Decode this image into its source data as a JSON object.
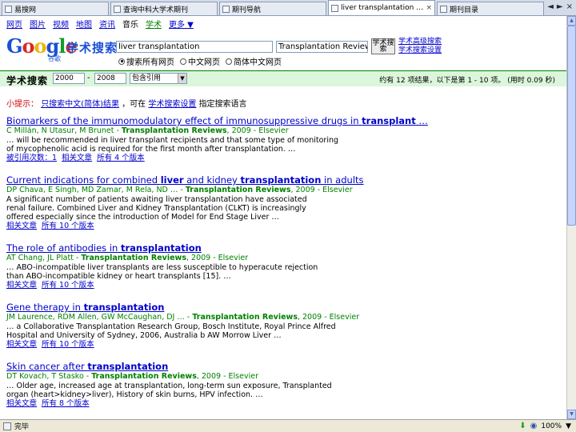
{
  "browser": {
    "tabs": [
      {
        "label": "易搜网",
        "active": false
      },
      {
        "label": "查询中科大学术期刊",
        "active": false
      },
      {
        "label": "期刊导航",
        "active": false
      },
      {
        "label": "liver transplantation - ...",
        "active": true
      },
      {
        "label": "期刊目录",
        "active": false
      }
    ],
    "close_glyph": "×",
    "nav_left": "◄",
    "nav_right": "►",
    "nav_close": "×"
  },
  "gnav": {
    "items": [
      "网页",
      "图片",
      "视频",
      "地图",
      "资讯",
      "音乐",
      "学术",
      "更多 ▼"
    ]
  },
  "logo": {
    "letters": [
      "G",
      "o",
      "o",
      "g",
      "l",
      "e"
    ],
    "subtext": "谷歌",
    "product": "学术搜索"
  },
  "search": {
    "query": "liver transplantation",
    "query2": "Transplantation Reviews",
    "button_label": "学术搜索",
    "advanced_link": "学术高级搜索",
    "settings_link": "学术搜索设置",
    "radios": [
      {
        "label": "搜索所有网页",
        "checked": true
      },
      {
        "label": "中文网页",
        "checked": false
      },
      {
        "label": "简体中文网页",
        "checked": false
      }
    ]
  },
  "results_bar": {
    "title": "学术搜索",
    "year_from": "2000",
    "dash": "-",
    "year_to": "2008",
    "filter_select": "包含引用",
    "arrow": "▼",
    "stats": "约有 12 项结果，以下是第 1 - 10 项。 (用时 0.09 秒)"
  },
  "suggestion": {
    "prefix": "小提示：",
    "link1": "只搜索中文(简体)结果",
    "middle": "，可在",
    "link2": "学术搜索设置",
    "suffix": "指定搜索语言"
  },
  "results": [
    {
      "title_parts": [
        {
          "text": "Biomarkers of the immunomodulatory effect of immunosuppressive drugs in ",
          "bold": false
        },
        {
          "text": "transplant",
          "bold": true
        },
        {
          "text": " …",
          "bold": false
        }
      ],
      "meta_parts": [
        {
          "text": "C Millán, N Utasur, M Brunet - ",
          "bold": false
        },
        {
          "text": "Transplantation Reviews",
          "bold": true
        },
        {
          "text": ", 2009 - Elsevier",
          "bold": false
        }
      ],
      "snippet": [
        "… will be recommended in liver transplant recipients and that some type of monitoring",
        "of mycophenolic acid is required for the first month after transplantation. …"
      ],
      "links": [
        "被引用次数：1",
        "相关文章",
        "所有 4 个版本"
      ]
    },
    {
      "title_parts": [
        {
          "text": "Current indications for combined ",
          "bold": false
        },
        {
          "text": "liver",
          "bold": true
        },
        {
          "text": " and kidney ",
          "bold": false
        },
        {
          "text": "transplantation",
          "bold": true
        },
        {
          "text": " in adults",
          "bold": false
        }
      ],
      "meta_parts": [
        {
          "text": "DP Chava, E Singh, MD Zamar, M Rela, ND … - ",
          "bold": false
        },
        {
          "text": "Transplantation Reviews",
          "bold": true
        },
        {
          "text": ", 2009 - Elsevier",
          "bold": false
        }
      ],
      "snippet": [
        "A significant number of patients awaiting liver transplantation have associated",
        "renal failure. Combined Liver and Kidney Transplantation (CLKT) is increasingly",
        "offered especially since the introduction of Model for End Stage Liver …"
      ],
      "links": [
        "相关文章",
        "所有 10 个版本"
      ]
    },
    {
      "title_parts": [
        {
          "text": "The role of antibodies in ",
          "bold": false
        },
        {
          "text": "transplantation",
          "bold": true
        }
      ],
      "meta_parts": [
        {
          "text": "AT Chang, JL Platt - ",
          "bold": false
        },
        {
          "text": "Transplantation Reviews",
          "bold": true
        },
        {
          "text": ", 2009 - Elsevier",
          "bold": false
        }
      ],
      "snippet": [
        "… ABO-incompatible liver transplants are less susceptible to hyperacute rejection",
        "than ABO-incompatible kidney or heart transplants [15]. …"
      ],
      "links": [
        "相关文章",
        "所有 10 个版本"
      ]
    },
    {
      "title_parts": [
        {
          "text": "Gene therapy in ",
          "bold": false
        },
        {
          "text": "transplantation",
          "bold": true
        }
      ],
      "meta_parts": [
        {
          "text": "JM Laurence, RDM Allen, GW McCaughan, DJ … - ",
          "bold": false
        },
        {
          "text": "Transplantation Reviews",
          "bold": true
        },
        {
          "text": ", 2009 - Elsevier",
          "bold": false
        }
      ],
      "snippet": [
        "… a Collaborative Transplantation Research Group, Bosch Institute, Royal Prince Alfred",
        "Hospital and University of Sydney, 2006, Australia b AW Morrow Liver …"
      ],
      "links": [
        "相关文章",
        "所有 10 个版本"
      ]
    },
    {
      "title_parts": [
        {
          "text": "Skin cancer after ",
          "bold": false
        },
        {
          "text": "transplantation",
          "bold": true
        }
      ],
      "meta_parts": [
        {
          "text": "DT Kovach, T Stasko - ",
          "bold": false
        },
        {
          "text": "Transplantation Reviews",
          "bold": true
        },
        {
          "text": ", 2009 - Elsevier",
          "bold": false
        }
      ],
      "snippet": [
        "… Older age, increased age at transplantation, long-term sun exposure, Transplanted",
        "organ (heart>kidney>liver), History of skin burns, HPV infection. …"
      ],
      "links": [
        "相关文章",
        "所有 8 个版本"
      ]
    }
  ],
  "status_bar": {
    "text": "完毕",
    "zoom": "100%",
    "zoom_arrow": "▼"
  }
}
